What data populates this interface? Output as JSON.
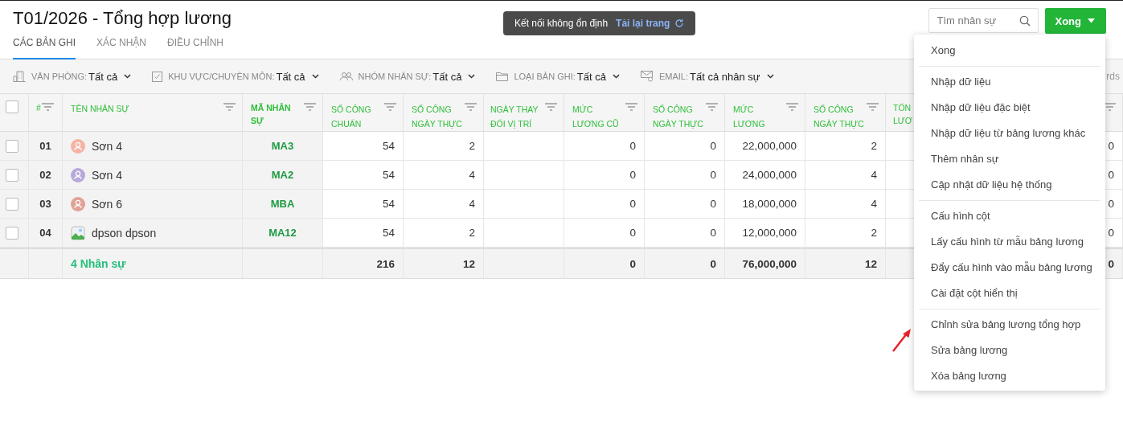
{
  "title": "T01/2026 - Tổng hợp lương",
  "tabs": [
    {
      "label": "CÁC BẢN GHI",
      "selected": true
    },
    {
      "label": "XÁC NHẬN",
      "selected": false
    },
    {
      "label": "ĐIỀU CHỈNH",
      "selected": false
    }
  ],
  "toast": {
    "message": "Kết nối không ổn định",
    "action": "Tải lại trang"
  },
  "search": {
    "placeholder": "Tìm nhân sự"
  },
  "primary_button": "Xong",
  "filters": [
    {
      "kind": "office",
      "label": "VĂN PHÒNG:",
      "value": "Tất cả"
    },
    {
      "kind": "check",
      "label": "KHU VỰC/CHUYÊN MÔN:",
      "value": "Tất cả"
    },
    {
      "kind": "group",
      "label": "NHÓM NHÂN SỰ:",
      "value": "Tất cả"
    },
    {
      "kind": "folder",
      "label": "LOẠI BẢN GHI:",
      "value": "Tất cả"
    },
    {
      "kind": "email",
      "label": "EMAIL:",
      "value": "Tất cả nhân sự"
    }
  ],
  "toolbar_trailing": "rds",
  "table": {
    "header_checked": false,
    "columns": [
      {
        "kind": "index",
        "label": "#"
      },
      {
        "kind": "name",
        "label": "TÊN NHÂN SỰ"
      },
      {
        "kind": "code",
        "label": "MÃ NHÂN SỰ"
      },
      {
        "kind": "number",
        "label": "SỐ CÔNG CHUẨN"
      },
      {
        "kind": "number",
        "label": "SỐ CÔNG NGÀY THỰC"
      },
      {
        "kind": "blank",
        "label": "NGÀY THAY ĐỔI VỊ TRÍ"
      },
      {
        "kind": "number",
        "label": "MỨC LƯƠNG CŨ"
      },
      {
        "kind": "number",
        "label": "SỐ CÔNG NGÀY THỰC"
      },
      {
        "kind": "number",
        "label": "MỨC LƯƠNG"
      },
      {
        "kind": "number",
        "label": "SỐ CÔNG NGÀY THỰC"
      },
      {
        "kind": "covered",
        "label": "TỔN LƯƠ"
      },
      {
        "kind": "tail"
      }
    ],
    "rows": [
      {
        "checked": false,
        "index": "01",
        "name": "Sơn 4",
        "avatar": {
          "kind": "person",
          "color": "#f7b3a2"
        },
        "code": "MA3",
        "values": [
          "54",
          "2",
          "0",
          "0",
          "22,000,000",
          "2",
          "0"
        ]
      },
      {
        "checked": false,
        "index": "02",
        "name": "Sơn 4",
        "avatar": {
          "kind": "person",
          "color": "#b8a9dc"
        },
        "code": "MA2",
        "values": [
          "54",
          "4",
          "0",
          "0",
          "24,000,000",
          "4",
          "0"
        ]
      },
      {
        "checked": false,
        "index": "03",
        "name": "Sơn 6",
        "avatar": {
          "kind": "person",
          "color": "#e0a197"
        },
        "code": "MBA",
        "values": [
          "54",
          "4",
          "0",
          "0",
          "18,000,000",
          "4",
          "0"
        ]
      },
      {
        "checked": false,
        "index": "04",
        "name": "dpson dpson",
        "code": "MA12",
        "values": [
          "54",
          "2",
          "0",
          "0",
          "12,000,000",
          "2",
          "0"
        ]
      }
    ],
    "footer": {
      "label": "4 Nhân sự",
      "values": [
        "216",
        "12",
        "0",
        "0",
        "76,000,000",
        "12",
        "0"
      ]
    }
  },
  "menu": [
    [
      "Xong"
    ],
    [
      "Nhập dữ liệu",
      "Nhập dữ liệu đặc biệt",
      "Nhập dữ liệu từ bảng lương khác",
      "Thêm nhân sự",
      "Cập nhật dữ liệu hệ thống"
    ],
    [
      "Cấu hình cột",
      "Lấy cấu hình từ mẫu bảng lương",
      "Đẩy cấu hình vào mẫu bảng lương",
      "Cài đặt cột hiển thị"
    ],
    [
      "Chỉnh sửa bảng lương tổng hợp",
      "Sửa bảng lương",
      "Xóa bảng lương"
    ]
  ],
  "annotation": {
    "kind": "arrow"
  }
}
